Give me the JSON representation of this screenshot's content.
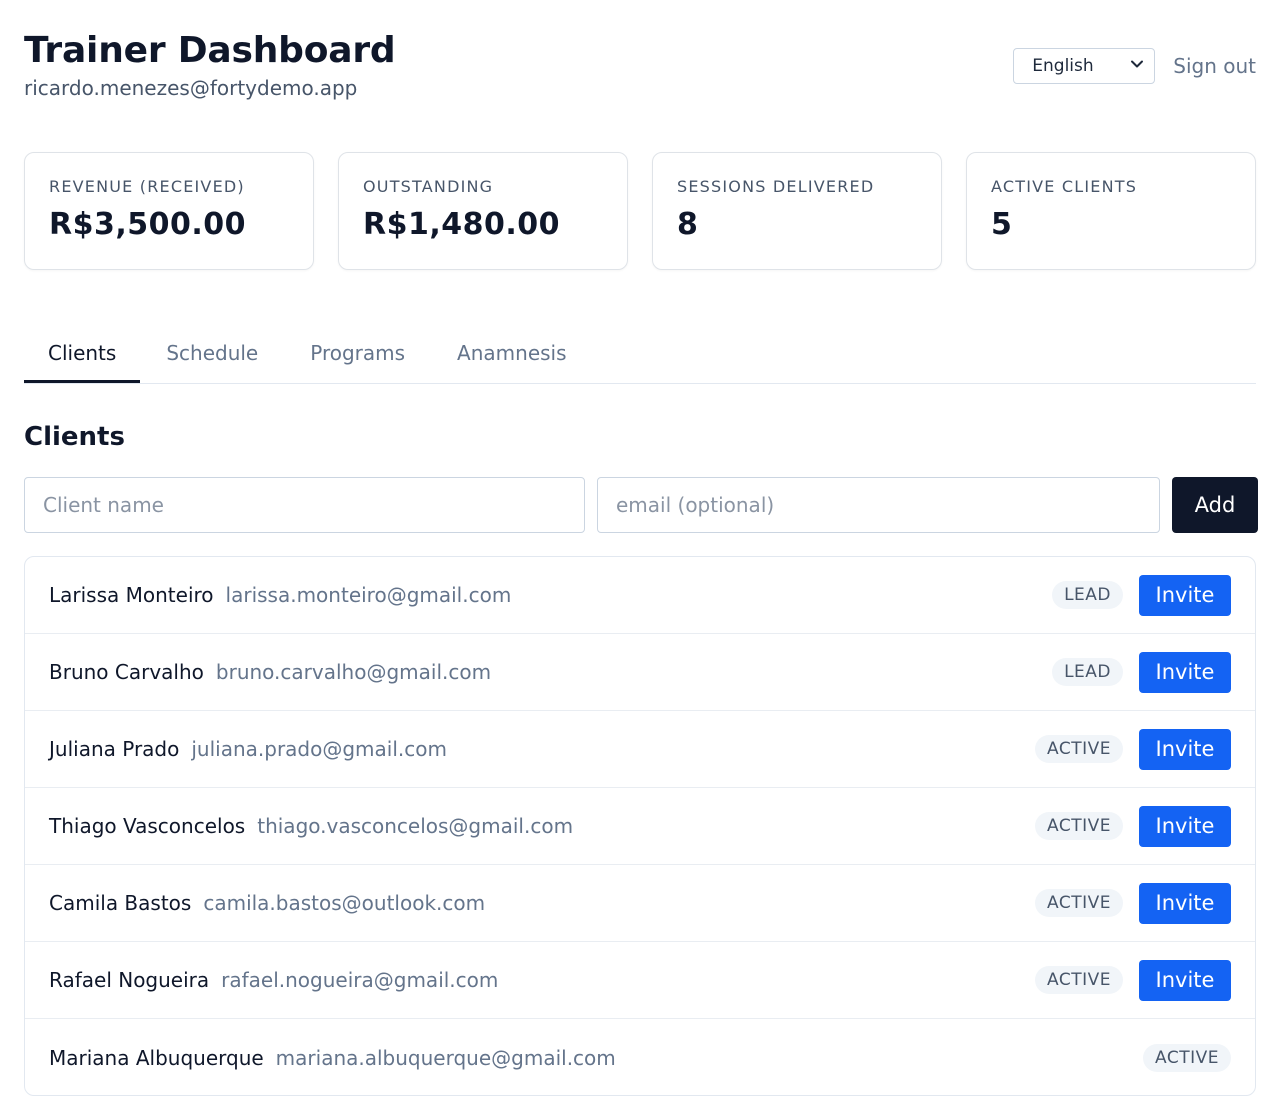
{
  "header": {
    "title": "Trainer Dashboard",
    "email": "ricardo.menezes@fortydemo.app",
    "language": "English",
    "sign_out": "Sign out"
  },
  "stats": [
    {
      "label": "REVENUE (RECEIVED)",
      "value": "R$3,500.00"
    },
    {
      "label": "OUTSTANDING",
      "value": "R$1,480.00"
    },
    {
      "label": "SESSIONS DELIVERED",
      "value": "8"
    },
    {
      "label": "ACTIVE CLIENTS",
      "value": "5"
    }
  ],
  "tabs": [
    {
      "label": "Clients",
      "active": true
    },
    {
      "label": "Schedule",
      "active": false
    },
    {
      "label": "Programs",
      "active": false
    },
    {
      "label": "Anamnesis",
      "active": false
    }
  ],
  "clients_section": {
    "title": "Clients",
    "name_placeholder": "Client name",
    "email_placeholder": "email (optional)",
    "add_label": "Add",
    "invite_label": "Invite"
  },
  "clients": [
    {
      "name": "Larissa Monteiro",
      "email": "larissa.monteiro@gmail.com",
      "status": "LEAD"
    },
    {
      "name": "Bruno Carvalho",
      "email": "bruno.carvalho@gmail.com",
      "status": "LEAD"
    },
    {
      "name": "Juliana Prado",
      "email": "juliana.prado@gmail.com",
      "status": "ACTIVE"
    },
    {
      "name": "Thiago Vasconcelos",
      "email": "thiago.vasconcelos@gmail.com",
      "status": "ACTIVE"
    },
    {
      "name": "Camila Bastos",
      "email": "camila.bastos@outlook.com",
      "status": "ACTIVE"
    },
    {
      "name": "Rafael Nogueira",
      "email": "rafael.nogueira@gmail.com",
      "status": "ACTIVE"
    },
    {
      "name": "Mariana Albuquerque",
      "email": "mariana.albuquerque@gmail.com",
      "status": "ACTIVE"
    }
  ],
  "colors": {
    "primary_dark": "#0f172a",
    "invite_blue": "#1463f3",
    "muted_text": "#64748b"
  }
}
